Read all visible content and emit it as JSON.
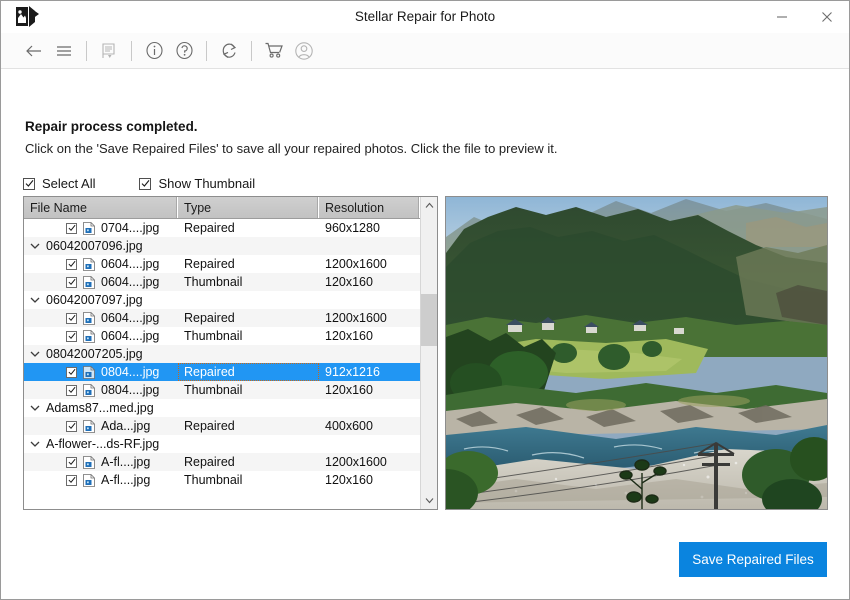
{
  "window": {
    "title": "Stellar Repair for Photo",
    "app_icon": "photo-export-icon",
    "minimize_label": "—",
    "close_label": "✕"
  },
  "toolbar": {
    "items": [
      {
        "name": "back-icon",
        "label": "Back"
      },
      {
        "name": "menu-icon",
        "label": "Menu"
      },
      {
        "name": "separator",
        "label": ""
      },
      {
        "name": "log-report-icon",
        "label": "Log Report"
      },
      {
        "name": "separator",
        "label": ""
      },
      {
        "name": "info-icon",
        "label": "About"
      },
      {
        "name": "help-icon",
        "label": "Help"
      },
      {
        "name": "separator",
        "label": ""
      },
      {
        "name": "refresh-icon",
        "label": "Refresh"
      },
      {
        "name": "separator",
        "label": ""
      },
      {
        "name": "cart-icon",
        "label": "Buy Now"
      },
      {
        "name": "account-icon",
        "label": "Account"
      }
    ]
  },
  "messages": {
    "primary": "Repair process completed.",
    "secondary": "Click on the 'Save Repaired Files' to save all your repaired photos. Click the file to preview it."
  },
  "options": {
    "select_all": {
      "label": "Select All",
      "checked": true
    },
    "show_thumbnail": {
      "label": "Show Thumbnail",
      "checked": true
    }
  },
  "file_list": {
    "columns": [
      "File Name",
      "Type",
      "Resolution"
    ],
    "rows": [
      {
        "kind": "child",
        "checked": true,
        "name": "0704....jpg",
        "type": "Repaired",
        "resolution": "960x1280",
        "selected": false
      },
      {
        "kind": "group",
        "checked": false,
        "name": "06042007096.jpg",
        "type": "",
        "resolution": "",
        "selected": false
      },
      {
        "kind": "child",
        "checked": true,
        "name": "0604....jpg",
        "type": "Repaired",
        "resolution": "1200x1600",
        "selected": false
      },
      {
        "kind": "child",
        "checked": true,
        "name": "0604....jpg",
        "type": "Thumbnail",
        "resolution": "120x160",
        "selected": false
      },
      {
        "kind": "group",
        "checked": false,
        "name": "06042007097.jpg",
        "type": "",
        "resolution": "",
        "selected": false
      },
      {
        "kind": "child",
        "checked": true,
        "name": "0604....jpg",
        "type": "Repaired",
        "resolution": "1200x1600",
        "selected": false
      },
      {
        "kind": "child",
        "checked": true,
        "name": "0604....jpg",
        "type": "Thumbnail",
        "resolution": "120x160",
        "selected": false
      },
      {
        "kind": "group",
        "checked": false,
        "name": "08042007205.jpg",
        "type": "",
        "resolution": "",
        "selected": false
      },
      {
        "kind": "child",
        "checked": true,
        "name": "0804....jpg",
        "type": "Repaired",
        "resolution": "912x1216",
        "selected": true
      },
      {
        "kind": "child",
        "checked": true,
        "name": "0804....jpg",
        "type": "Thumbnail",
        "resolution": "120x160",
        "selected": false
      },
      {
        "kind": "group",
        "checked": false,
        "name": "Adams87...med.jpg",
        "type": "",
        "resolution": "",
        "selected": false
      },
      {
        "kind": "child",
        "checked": true,
        "name": "Ada...jpg",
        "type": "Repaired",
        "resolution": "400x600",
        "selected": false
      },
      {
        "kind": "group",
        "checked": false,
        "name": "A-flower-...ds-RF.jpg",
        "type": "",
        "resolution": "",
        "selected": false
      },
      {
        "kind": "child",
        "checked": true,
        "name": "A-fl....jpg",
        "type": "Repaired",
        "resolution": "1200x1600",
        "selected": false
      },
      {
        "kind": "child",
        "checked": true,
        "name": "A-fl....jpg",
        "type": "Thumbnail",
        "resolution": "120x160",
        "selected": false
      }
    ],
    "scrollbar": {
      "up_icon": "chevron-up-icon",
      "down_icon": "chevron-down-icon"
    }
  },
  "preview": {
    "alt": "Mountain valley landscape with river, forested hills and a village"
  },
  "footer": {
    "save_label": "Save Repaired Files"
  },
  "colors": {
    "accent": "#0a84df",
    "selection": "#2196f3",
    "header_gray": "#c8c8c8",
    "focus_outline": "#c96a18"
  }
}
